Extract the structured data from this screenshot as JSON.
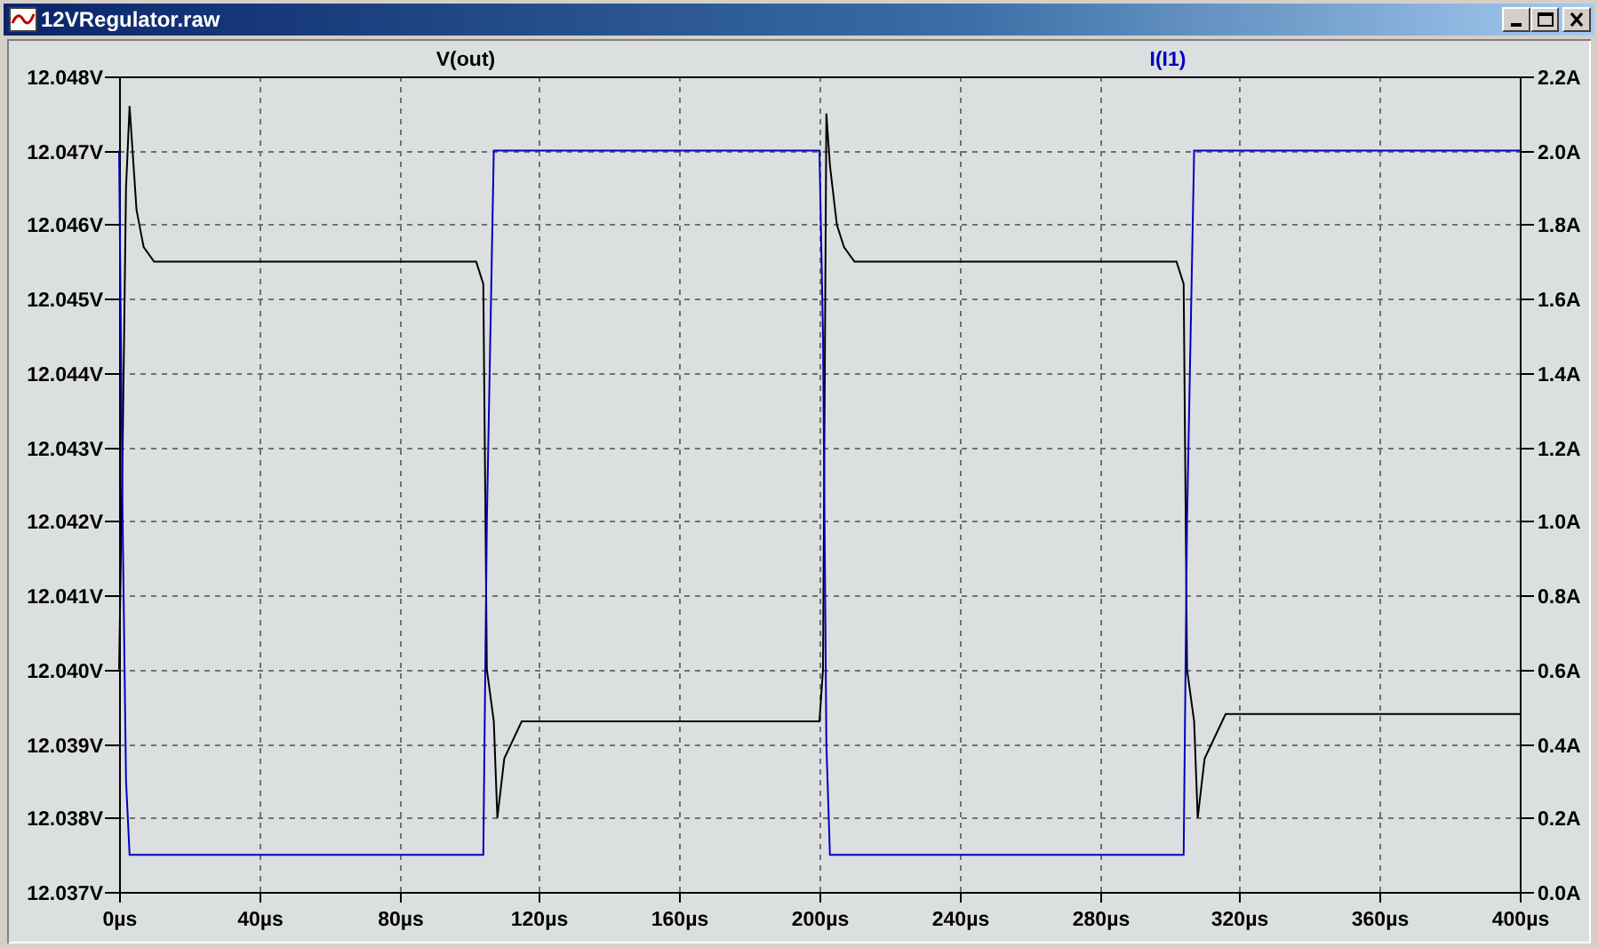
{
  "window": {
    "title": "12VRegulator.raw",
    "controls": [
      {
        "kind": "minimize"
      },
      {
        "kind": "maximize"
      },
      {
        "kind": "close"
      }
    ]
  },
  "plot": {
    "chart_data": {
      "type": "line",
      "grid": true,
      "xlim": [
        0,
        400
      ],
      "ylim": [
        12.037,
        12.048
      ],
      "y2lim": [
        0,
        2.2
      ],
      "x": [
        0,
        1,
        2,
        3,
        5,
        7,
        10,
        102,
        104,
        105,
        107,
        108,
        110,
        115,
        200,
        201,
        202,
        203,
        205,
        207,
        210,
        302,
        304,
        305,
        307,
        308,
        310,
        316,
        400
      ],
      "series": [
        {
          "name": "V(out)",
          "color": "#000000",
          "axis": "y",
          "values": [
            12.04,
            12.043,
            12.0465,
            12.0476,
            12.0462,
            12.0457,
            12.0455,
            12.0455,
            12.0452,
            12.04,
            12.0393,
            12.038,
            12.0388,
            12.0393,
            12.0393,
            12.04,
            12.0475,
            12.0468,
            12.046,
            12.0457,
            12.0455,
            12.0455,
            12.0452,
            12.04,
            12.0393,
            12.038,
            12.0388,
            12.0394,
            12.0394
          ]
        },
        {
          "name": "I(I1)",
          "color": "#0000c0",
          "axis": "y2",
          "values": [
            2.0,
            1.0,
            0.3,
            0.1,
            0.1,
            0.1,
            0.1,
            0.1,
            0.1,
            1.0,
            2.0,
            2.0,
            2.0,
            2.0,
            2.0,
            1.5,
            0.4,
            0.1,
            0.1,
            0.1,
            0.1,
            0.1,
            0.1,
            1.0,
            2.0,
            2.0,
            2.0,
            2.0,
            2.0
          ]
        }
      ],
      "xticks": [
        {
          "value": 0,
          "label": "0µs"
        },
        {
          "value": 40,
          "label": "40µs"
        },
        {
          "value": 80,
          "label": "80µs"
        },
        {
          "value": 120,
          "label": "120µs"
        },
        {
          "value": 160,
          "label": "160µs"
        },
        {
          "value": 200,
          "label": "200µs"
        },
        {
          "value": 240,
          "label": "240µs"
        },
        {
          "value": 280,
          "label": "280µs"
        },
        {
          "value": 320,
          "label": "320µs"
        },
        {
          "value": 360,
          "label": "360µs"
        },
        {
          "value": 400,
          "label": "400µs"
        }
      ],
      "yticks": [
        {
          "value": 12.048,
          "label": "12.048V"
        },
        {
          "value": 12.047,
          "label": "12.047V"
        },
        {
          "value": 12.046,
          "label": "12.046V"
        },
        {
          "value": 12.045,
          "label": "12.045V"
        },
        {
          "value": 12.044,
          "label": "12.044V"
        },
        {
          "value": 12.043,
          "label": "12.043V"
        },
        {
          "value": 12.042,
          "label": "12.042V"
        },
        {
          "value": 12.041,
          "label": "12.041V"
        },
        {
          "value": 12.04,
          "label": "12.040V"
        },
        {
          "value": 12.039,
          "label": "12.039V"
        },
        {
          "value": 12.038,
          "label": "12.038V"
        },
        {
          "value": 12.037,
          "label": "12.037V"
        }
      ],
      "y2ticks": [
        {
          "value": 2.2,
          "label": "2.2A"
        },
        {
          "value": 2.0,
          "label": "2.0A"
        },
        {
          "value": 1.8,
          "label": "1.8A"
        },
        {
          "value": 1.6,
          "label": "1.6A"
        },
        {
          "value": 1.4,
          "label": "1.4A"
        },
        {
          "value": 1.2,
          "label": "1.2A"
        },
        {
          "value": 1.0,
          "label": "1.0A"
        },
        {
          "value": 0.8,
          "label": "0.8A"
        },
        {
          "value": 0.6,
          "label": "0.6A"
        },
        {
          "value": 0.4,
          "label": "0.4A"
        },
        {
          "value": 0.2,
          "label": "0.2A"
        },
        {
          "value": 0.0,
          "label": "0.0A"
        }
      ]
    }
  }
}
